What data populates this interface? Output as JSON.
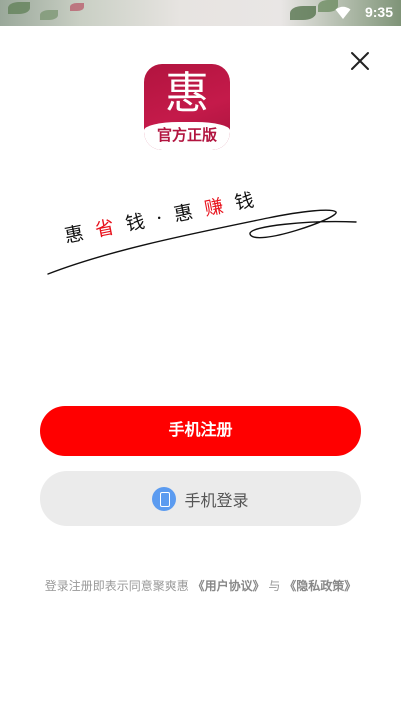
{
  "status_bar": {
    "time": "9:35"
  },
  "logo": {
    "char": "惠",
    "banner": "官方正版"
  },
  "slogan": {
    "part1": "惠",
    "part2": "省",
    "part3": "钱 · 惠",
    "part4": "赚",
    "part5": "钱"
  },
  "buttons": {
    "register": "手机注册",
    "login": "手机登录"
  },
  "terms": {
    "prefix": "登录注册即表示同意聚爽惠",
    "user_agreement": "《用户协议》",
    "and": "与",
    "privacy_policy": "《隐私政策》"
  }
}
